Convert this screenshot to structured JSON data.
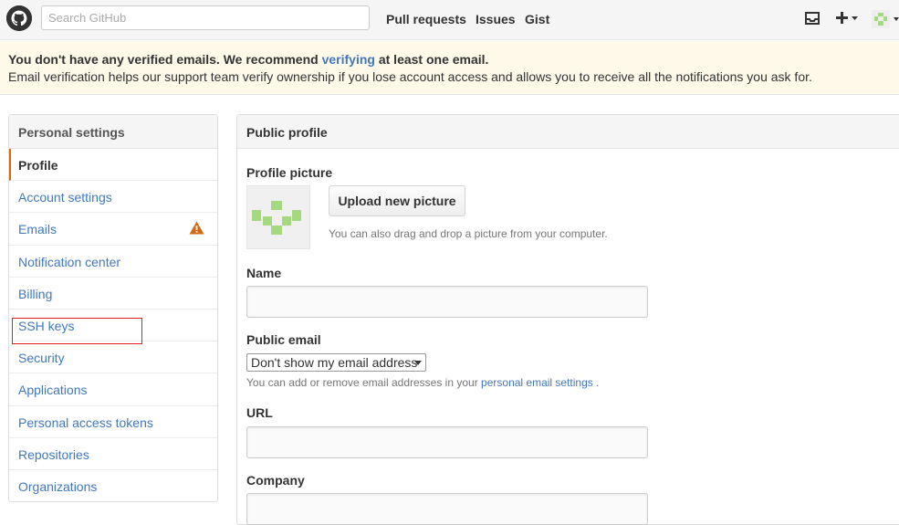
{
  "header": {
    "search_placeholder": "Search GitHub",
    "nav": [
      "Pull requests",
      "Issues",
      "Gist"
    ],
    "icons": [
      "github-logo",
      "inbox-icon",
      "plus-icon",
      "avatar-icon"
    ]
  },
  "flash": {
    "line1_before": "You don't have any verified emails. We recommend ",
    "line1_link": "verifying",
    "line1_after": " at least one email.",
    "line2": "Email verification helps our support team verify ownership if you lose account access and allows you to receive all the notifications you ask for."
  },
  "sidebar": {
    "title": "Personal settings",
    "items": [
      {
        "label": "Profile"
      },
      {
        "label": "Account settings"
      },
      {
        "label": "Emails"
      },
      {
        "label": "Notification center"
      },
      {
        "label": "Billing"
      },
      {
        "label": "SSH keys"
      },
      {
        "label": "Security"
      },
      {
        "label": "Applications"
      },
      {
        "label": "Personal access tokens"
      },
      {
        "label": "Repositories"
      },
      {
        "label": "Organizations"
      }
    ]
  },
  "main": {
    "title": "Public profile",
    "profile_picture_label": "Profile picture",
    "upload_button": "Upload new picture",
    "upload_note": "You can also drag and drop a picture from your computer.",
    "name_label": "Name",
    "name_value": "",
    "public_email_label": "Public email",
    "public_email_selected": "Don't show my email address",
    "email_note_before": "You can add or remove email addresses in your ",
    "email_note_link": "personal email settings",
    "email_note_after": " .",
    "url_label": "URL",
    "url_value": "",
    "company_label": "Company",
    "company_value": ""
  },
  "colors": {
    "link": "#4078c0",
    "selected_border": "#d26911",
    "flash_bg": "#fff9ea",
    "warning": "#d26911",
    "avatar_green": "#a6d87f",
    "highlight_box": "#e02020"
  }
}
